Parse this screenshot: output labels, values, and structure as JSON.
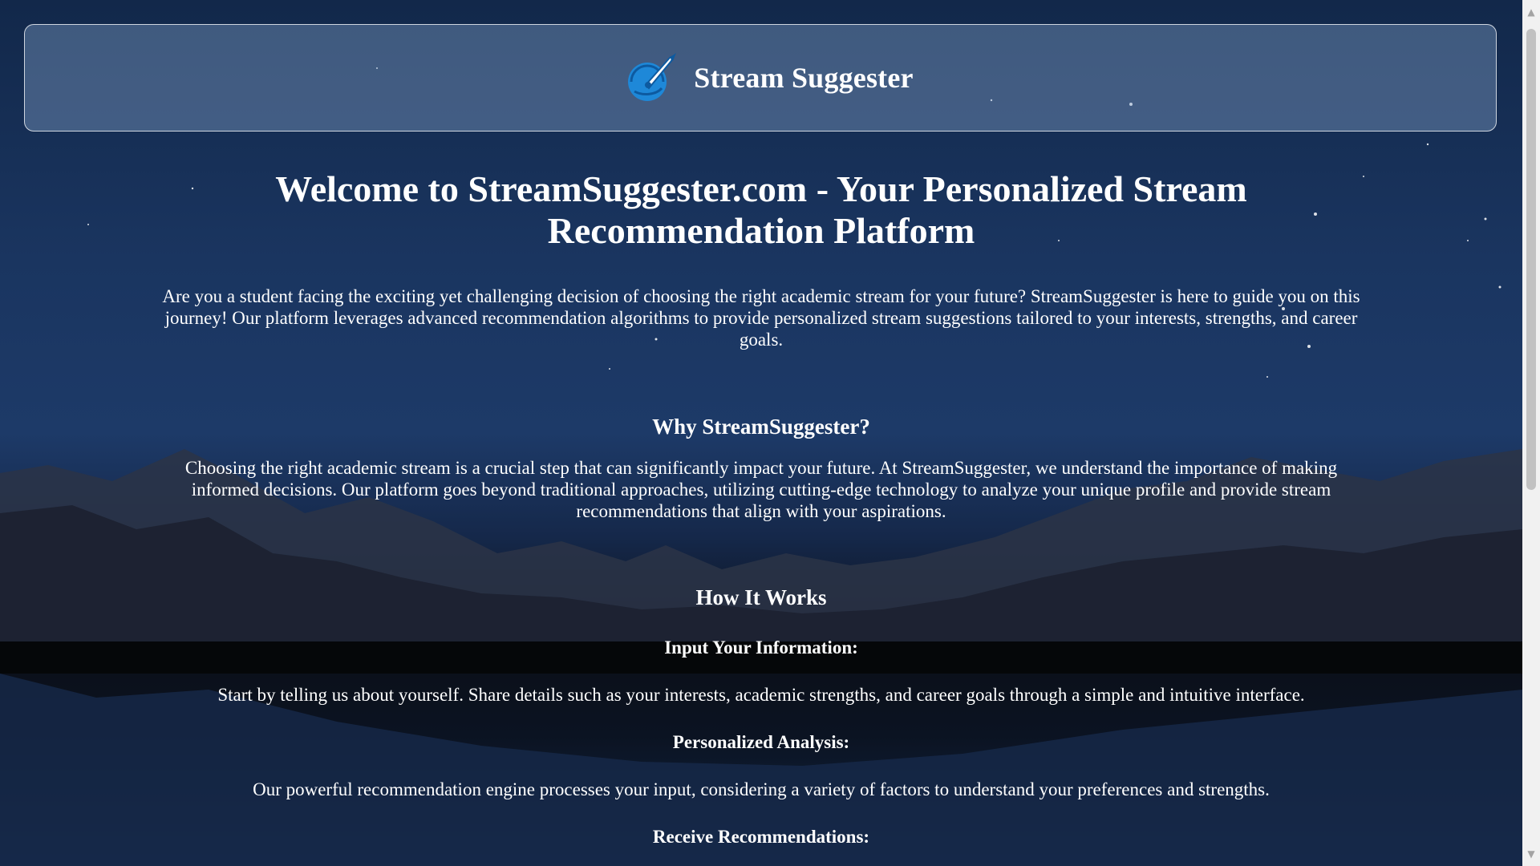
{
  "header": {
    "brand_name": "Stream Suggester",
    "logo_icon": "rocket-globe-icon"
  },
  "main": {
    "title": "Welcome to StreamSuggester.com - Your Personalized Stream Recommendation Platform",
    "intro": "Are you a student facing the exciting yet challenging decision of choosing the right academic stream for your future? StreamSuggester is here to guide you on this journey! Our platform leverages advanced recommendation algorithms to provide personalized stream suggestions tailored to your interests, strengths, and career goals.",
    "why": {
      "title": "Why StreamSuggester?",
      "text": "Choosing the right academic stream is a crucial step that can significantly impact your future. At StreamSuggester, we understand the importance of making informed decisions. Our platform goes beyond traditional approaches, utilizing cutting-edge technology to analyze your unique profile and provide stream recommendations that align with your aspirations."
    },
    "how": {
      "title": "How It Works",
      "steps": [
        {
          "title": "Input Your Information:",
          "text": "Start by telling us about yourself. Share details such as your interests, academic strengths, and career goals through a simple and intuitive interface."
        },
        {
          "title": "Personalized Analysis:",
          "text": "Our powerful recommendation engine processes your input, considering a variety of factors to understand your preferences and strengths."
        },
        {
          "title": "Receive Recommendations:"
        }
      ]
    }
  },
  "colors": {
    "header_border": "#ffffff",
    "text": "#ffffff",
    "logo_blue": "#1e88d8"
  }
}
